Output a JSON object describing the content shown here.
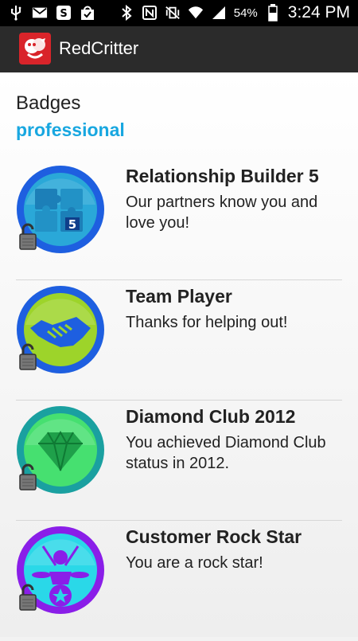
{
  "status_bar": {
    "battery_percent": "54%",
    "time": "3:24 PM",
    "icons": [
      "usb-icon",
      "gmail-icon",
      "shazam-icon",
      "shopping-bag-icon",
      "bluetooth-icon",
      "nfc-icon",
      "vibrate-mute-icon",
      "wifi-icon",
      "signal-icon",
      "battery-icon"
    ]
  },
  "app": {
    "title": "RedCritter",
    "logo": "redcritter-logo-icon"
  },
  "section": {
    "title": "Badges",
    "subtitle": "professional"
  },
  "badges": [
    {
      "name": "Relationship Builder 5",
      "description": "Our partners know you and love you!",
      "icon": "puzzle-badge-icon",
      "ring_color": "#1e5fe0",
      "fill_color": "#2aa8d8"
    },
    {
      "name": "Team Player",
      "description": "Thanks for helping out!",
      "icon": "handshake-badge-icon",
      "ring_color": "#1e5fe0",
      "fill_color": "#9dd42a"
    },
    {
      "name": "Diamond Club 2012",
      "description": "You achieved Diamond Club status in 2012.",
      "icon": "diamond-badge-icon",
      "ring_color": "#1aa0a0",
      "fill_color": "#46e070"
    },
    {
      "name": "Customer Rock Star",
      "description": "You are a rock star!",
      "icon": "drummer-badge-icon",
      "ring_color": "#8a1ee8",
      "fill_color": "#2ad8e8"
    }
  ],
  "colors": {
    "accent": "#18a7e0",
    "appbar": "#2b2b2b",
    "brand_red": "#d9242a"
  }
}
